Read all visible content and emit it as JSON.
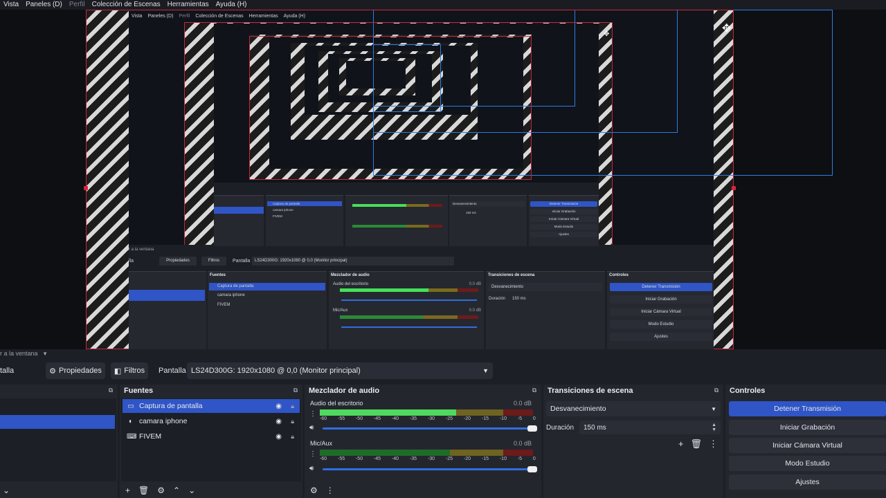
{
  "menu": {
    "items": [
      {
        "label": "Vista",
        "enabled": true
      },
      {
        "label": "Paneles (D)",
        "enabled": true
      },
      {
        "label": "Perfil",
        "enabled": false
      },
      {
        "label": "Colección de Escenas",
        "enabled": true
      },
      {
        "label": "Herramientas",
        "enabled": true
      },
      {
        "label": "Ayuda (H)",
        "enabled": true
      }
    ]
  },
  "preview": {
    "mid_menu": [
      "Vista",
      "Paneles (D)",
      "Perfil",
      "Colección de Escenas",
      "Herramientas",
      "Ayuda (H)"
    ],
    "mid_toolbar": {
      "window_label": "r a la ventana",
      "scene_partial": "lla",
      "properties": "Propiedades",
      "filters": "Filtros",
      "source_type": "Pantalla",
      "display": "LS24D300G: 1920x1080 @ 0,0 (Monitor principal)"
    },
    "mid_docks": {
      "sources_title": "Fuentes",
      "sources": [
        "Captura de pantalla",
        "camara iphone",
        "FIVEM"
      ],
      "mixer_title": "Mezclador de audio",
      "mixer_channels": [
        {
          "name": "Audio del escritorio",
          "db": "0.0 dB"
        },
        {
          "name": "Mic/Aux",
          "db": "0.0 dB"
        }
      ],
      "transitions_title": "Transiciones de escena",
      "transition": "Desvanecimiento",
      "duration_label": "Duración",
      "duration_value": "150 ms",
      "controls_title": "Controles",
      "controls": [
        "Detener Transmisión",
        "Iniciar Grabación",
        "Iniciar Cámara Virtual",
        "Modo Estudio",
        "Ajustes"
      ]
    },
    "small_docks": {
      "sources": [
        "Captura de pantalla",
        "camara iphone",
        "FIVEM"
      ],
      "controls": [
        "Detener Transmisión",
        "Iniciar Grabación",
        "Iniciar Cámara Virtual",
        "Modo Estudio",
        "Ajustes"
      ],
      "transition": "Desvanecimiento",
      "duration_value": "150 ms"
    }
  },
  "toolbar": {
    "window_label": "r a la ventana",
    "scene_partial": "talla",
    "properties_label": "Propiedades",
    "filters_label": "Filtros",
    "source_type": "Pantalla",
    "display_value": "LS24D300G: 1920x1080 @ 0,0 (Monitor principal)"
  },
  "sources_dock": {
    "title": "Fuentes",
    "items": [
      {
        "name": "Captura de pantalla",
        "icon": "monitor-icon",
        "selected": true
      },
      {
        "name": "camara iphone",
        "icon": "camera-icon",
        "selected": false
      },
      {
        "name": "FIVEM",
        "icon": "gamepad-icon",
        "selected": false
      }
    ]
  },
  "mixer_dock": {
    "title": "Mezclador de audio",
    "channels": [
      {
        "name": "Audio del escritorio",
        "db": "0.0 dB",
        "level": 0.64
      },
      {
        "name": "Mic/Aux",
        "db": "0.0 dB",
        "level": 0
      }
    ],
    "scale": [
      "-60",
      "-55",
      "-50",
      "-45",
      "-40",
      "-35",
      "-30",
      "-25",
      "-20",
      "-15",
      "-10",
      "-5",
      "0"
    ]
  },
  "transitions_dock": {
    "title": "Transiciones de escena",
    "transition": "Desvanecimiento",
    "duration_label": "Duración",
    "duration_value": "150 ms"
  },
  "controls_dock": {
    "title": "Controles",
    "buttons": [
      "Detener Transmisión",
      "Iniciar Grabación",
      "Iniciar Cámara Virtual",
      "Modo Estudio",
      "Ajustes"
    ]
  },
  "colors": {
    "accent": "#2f55c6",
    "selection_red": "#c9263a",
    "bounding_blue": "#2b7fe0",
    "dock_bg": "#24262e"
  }
}
